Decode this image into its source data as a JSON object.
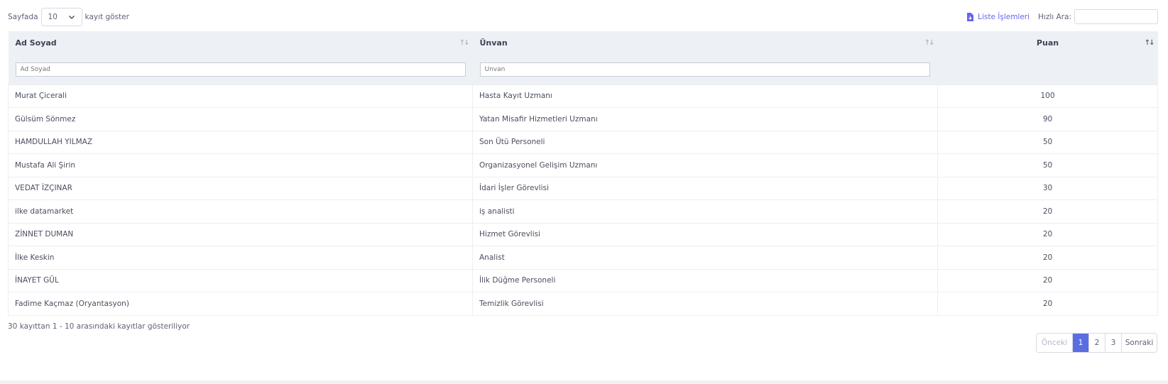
{
  "length_menu": {
    "prefix": "Sayfada",
    "selected": "10",
    "suffix": "kayıt göster"
  },
  "toolbar": {
    "list_ops_label": "Liste İşlemleri",
    "quick_search_label": "Hızlı Ara:",
    "quick_search_value": ""
  },
  "table": {
    "columns": [
      "Ad Soyad",
      "Ünvan",
      "Puan"
    ],
    "filter_placeholders": [
      "Ad Soyad",
      "Ünvan"
    ],
    "rows": [
      {
        "name": "Murat Çicerali",
        "title": "Hasta Kayıt Uzmanı",
        "score": "100"
      },
      {
        "name": "Gülsüm Sönmez",
        "title": "Yatan Misafir Hizmetleri Uzmanı",
        "score": "90"
      },
      {
        "name": "HAMDULLAH YILMAZ",
        "title": "Son Ütü Personeli",
        "score": "50"
      },
      {
        "name": "Mustafa Ali Şirin",
        "title": "Organizasyonel Gelişim Uzmanı",
        "score": "50"
      },
      {
        "name": "VEDAT İZÇINAR",
        "title": "İdari İşler Görevlisi",
        "score": "30"
      },
      {
        "name": "ilke datamarket",
        "title": "iş analisti",
        "score": "20"
      },
      {
        "name": "ZİNNET DUMAN",
        "title": "Hizmet Görevlisi",
        "score": "20"
      },
      {
        "name": "İlke Keskin",
        "title": "Analist",
        "score": "20"
      },
      {
        "name": "İNAYET GÜL",
        "title": "İlik Düğme Personeli",
        "score": "20"
      },
      {
        "name": "Fadime Kaçmaz (Oryantasyon)",
        "title": "Temizlik Görevlisi",
        "score": "20"
      }
    ]
  },
  "info_text": "30 kayıttan 1 - 10 arasındaki kayıtlar gösteriliyor",
  "pagination": {
    "prev": "Önceki",
    "pages": [
      "1",
      "2",
      "3"
    ],
    "active_page": "1",
    "next": "Sonraki"
  },
  "colors": {
    "accent": "#5b6ee1",
    "link": "#6366f1",
    "header_bg": "#edf0f5"
  }
}
